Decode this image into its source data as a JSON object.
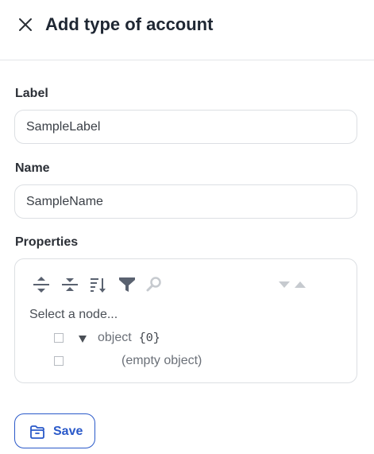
{
  "header": {
    "title": "Add type of account",
    "close_icon": "close-icon"
  },
  "form": {
    "label_field": {
      "label": "Label",
      "value": "SampleLabel"
    },
    "name_field": {
      "label": "Name",
      "value": "SampleName"
    },
    "properties": {
      "label": "Properties",
      "toolbar": {
        "icons": [
          "expand-all-icon",
          "collapse-all-icon",
          "sort-icon",
          "filter-icon",
          "search-icon",
          "previous-match-icon",
          "next-match-icon"
        ]
      },
      "node_path": "Select a node...",
      "tree": {
        "root_key": "object",
        "root_count": "{0}",
        "empty_text": "(empty object)"
      }
    }
  },
  "footer": {
    "save_label": "Save",
    "save_icon": "folder-open-icon"
  },
  "colors": {
    "accent": "#2a59c9",
    "border": "#dcdfe3",
    "toolbar_icon": "#5a6270",
    "disabled_icon": "#c6cacf"
  }
}
